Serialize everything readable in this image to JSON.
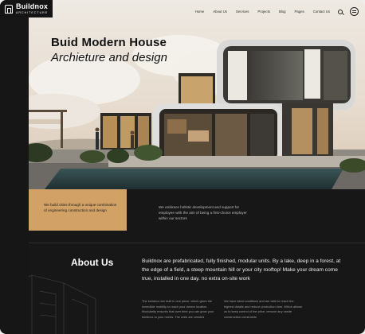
{
  "brand": {
    "name": "Buildnox",
    "tagline": "ARCHITECTURE"
  },
  "nav": {
    "items": [
      "Home",
      "About Us",
      "Services",
      "Projects",
      "Blog",
      "Pages",
      "Contact Us"
    ],
    "icons": [
      "search-icon",
      "menu-icon"
    ]
  },
  "hero": {
    "title": "Buid Modern House",
    "subtitle": "Archieture and design"
  },
  "band": {
    "cta_text": "We build cities through a unique combination of engineering construction and design",
    "text": "We embrace holistic development and support for employee with the aim of being a first-choice employer within our sectors"
  },
  "about": {
    "title": "About Us",
    "lead": "Buildnox are prefabricated, fully finished, modular units. By a lake, deep in a forest, at the edge of a field, a steep mountain hill or your city rooftop! Make your dream come true, installed in one day. no extra on-site work",
    "col1": "The buildnox are built in one piece, which gives the incredible mobility to reach your dream location. Modularity ensures that over time you can grow your buildnox to your needs. The units are created",
    "col2": "We have ideal conditions and are able to reach the highest details and reduce production time. Which allows us to keep control of the price, remove any onsite construction constraints"
  },
  "colors": {
    "accent": "#d2a165",
    "dark": "#171717",
    "sky": "#efe7dd"
  }
}
